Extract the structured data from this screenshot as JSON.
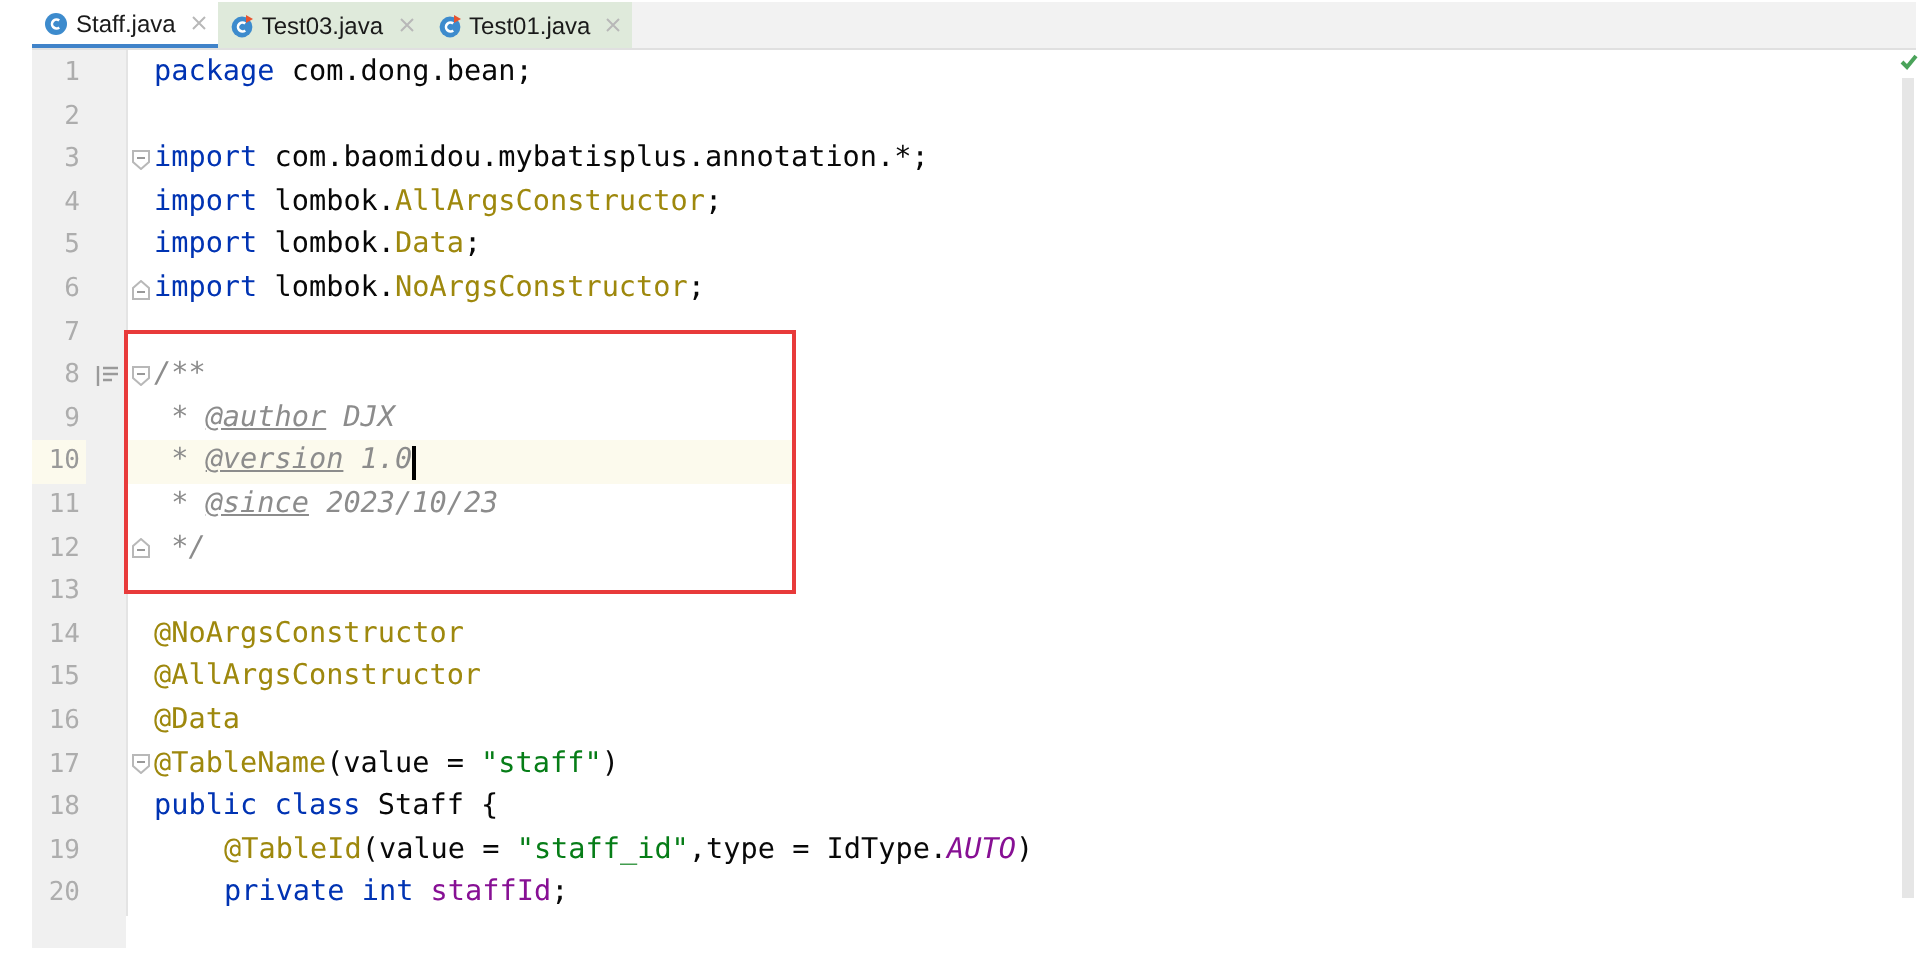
{
  "tabs": [
    {
      "label": "Staff.java",
      "selected": true,
      "kind": "class"
    },
    {
      "label": "Test03.java",
      "selected": false,
      "kind": "test"
    },
    {
      "label": "Test01.java",
      "selected": false,
      "kind": "test"
    }
  ],
  "editor": {
    "lines": [
      {
        "number": "1",
        "current": false,
        "tokens": [
          {
            "t": "package ",
            "kind": "keyword"
          },
          {
            "t": "com.dong.bean;",
            "kind": "plain"
          }
        ]
      },
      {
        "number": "2",
        "current": false
      },
      {
        "number": "3",
        "current": false,
        "fold_open": true,
        "tokens": [
          {
            "t": "import ",
            "kind": "keyword"
          },
          {
            "t": "com.baomidou.mybatisplus.annotation.*;",
            "kind": "plain"
          }
        ]
      },
      {
        "number": "4",
        "current": false,
        "tokens": [
          {
            "t": "import ",
            "kind": "keyword"
          },
          {
            "t": "lombok.",
            "kind": "plain"
          },
          {
            "t": "AllArgsConstructor",
            "kind": "annotation"
          },
          {
            "t": ";",
            "kind": "plain"
          }
        ]
      },
      {
        "number": "5",
        "current": false,
        "tokens": [
          {
            "t": "import ",
            "kind": "keyword"
          },
          {
            "t": "lombok.",
            "kind": "plain"
          },
          {
            "t": "Data",
            "kind": "annotation"
          },
          {
            "t": ";",
            "kind": "plain"
          }
        ]
      },
      {
        "number": "6",
        "current": false,
        "fold_close": true,
        "tokens": [
          {
            "t": "import ",
            "kind": "keyword"
          },
          {
            "t": "lombok.",
            "kind": "plain"
          },
          {
            "t": "NoArgsConstructor",
            "kind": "annotation"
          },
          {
            "t": ";",
            "kind": "plain"
          }
        ]
      },
      {
        "number": "7",
        "current": false
      },
      {
        "number": "8",
        "current": false,
        "fold_open": true,
        "doc_toggle": true,
        "boxed": true,
        "tokens": [
          {
            "t": "/**",
            "kind": "comment"
          }
        ]
      },
      {
        "number": "9",
        "current": false,
        "boxed": true,
        "tokens": [
          {
            "t": " * ",
            "kind": "comment"
          },
          {
            "t": "@author",
            "kind": "doctag"
          },
          {
            "t": " DJX",
            "kind": "comment"
          }
        ]
      },
      {
        "number": "10",
        "boxed": true,
        "current": true,
        "tokens": [
          {
            "t": " * ",
            "kind": "comment"
          },
          {
            "t": "@version",
            "kind": "doctag"
          },
          {
            "t": " 1.0",
            "kind": "comment"
          }
        ]
      },
      {
        "number": "11",
        "current": false,
        "boxed": true,
        "tokens": [
          {
            "t": " * ",
            "kind": "comment"
          },
          {
            "t": "@since",
            "kind": "doctag"
          },
          {
            "t": " 2023/10/23",
            "kind": "comment"
          }
        ]
      },
      {
        "number": "12",
        "current": false,
        "fold_close": true,
        "boxed": true,
        "tokens": [
          {
            "t": " */",
            "kind": "comment"
          }
        ]
      },
      {
        "number": "13",
        "current": false
      },
      {
        "number": "14",
        "current": false,
        "tokens": [
          {
            "t": "@NoArgsConstructor",
            "kind": "annotation"
          }
        ]
      },
      {
        "number": "15",
        "current": false,
        "tokens": [
          {
            "t": "@AllArgsConstructor",
            "kind": "annotation"
          }
        ]
      },
      {
        "number": "16",
        "current": false,
        "tokens": [
          {
            "t": "@Data",
            "kind": "annotation"
          }
        ]
      },
      {
        "number": "17",
        "current": false,
        "fold_open": true,
        "tokens": [
          {
            "t": "@TableName",
            "kind": "annotation"
          },
          {
            "t": "(value = ",
            "kind": "plain"
          },
          {
            "t": "\"staff\"",
            "kind": "string"
          },
          {
            "t": ")",
            "kind": "plain"
          }
        ]
      },
      {
        "number": "18",
        "current": false,
        "tokens": [
          {
            "t": "public class ",
            "kind": "keyword"
          },
          {
            "t": "Staff {",
            "kind": "plain"
          }
        ]
      },
      {
        "number": "19",
        "current": false,
        "indented": true,
        "tokens": [
          {
            "t": "@TableId",
            "kind": "annotation"
          },
          {
            "t": "(value = ",
            "kind": "plain"
          },
          {
            "t": "\"staff_id\"",
            "kind": "string"
          },
          {
            "t": ",type = IdType.",
            "kind": "plain"
          },
          {
            "t": "AUTO",
            "kind": "constant"
          },
          {
            "t": ")",
            "kind": "plain"
          }
        ]
      },
      {
        "number": "20",
        "current": false,
        "indented": true,
        "tokens": [
          {
            "t": "private int ",
            "kind": "keyword"
          },
          {
            "t": "staffId",
            "kind": "field"
          },
          {
            "t": ";",
            "kind": "plain"
          }
        ]
      }
    ]
  }
}
